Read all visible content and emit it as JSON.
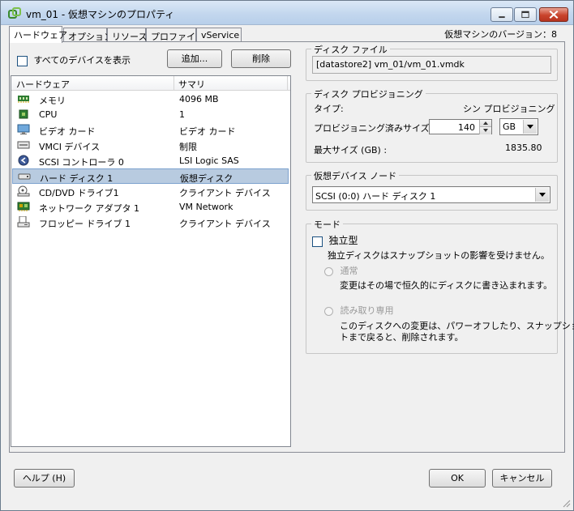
{
  "window": {
    "title": "vm_01 - 仮想マシンのプロパティ",
    "icon": "vm-icon"
  },
  "tabs": [
    {
      "label": "ハードウェア",
      "active": true
    },
    {
      "label": "オプション",
      "active": false
    },
    {
      "label": "リソース",
      "active": false
    },
    {
      "label": "プロファイル",
      "active": false
    },
    {
      "label": "vService",
      "active": false
    }
  ],
  "version_label": "仮想マシンのバージョン：8",
  "hardware": {
    "show_all_label": "すべてのデバイスを表示",
    "add_button": "追加...",
    "remove_button": "削除",
    "columns": [
      "ハードウェア",
      "サマリ"
    ],
    "rows": [
      {
        "icon": "memory-icon",
        "name": "メモリ",
        "summary": "4096 MB"
      },
      {
        "icon": "cpu-icon",
        "name": "CPU",
        "summary": "1"
      },
      {
        "icon": "video-card-icon",
        "name": "ビデオ カード",
        "summary": "ビデオ カード"
      },
      {
        "icon": "vmci-device-icon",
        "name": "VMCI デバイス",
        "summary": "制限"
      },
      {
        "icon": "scsi-controller-icon",
        "name": "SCSI コントローラ 0",
        "summary": "LSI Logic SAS"
      },
      {
        "icon": "hard-disk-icon",
        "name": "ハード ディスク 1",
        "summary": "仮想ディスク",
        "selected": true
      },
      {
        "icon": "cd-dvd-icon",
        "name": "CD/DVD ドライブ1",
        "summary": "クライアント デバイス"
      },
      {
        "icon": "network-adapter-icon",
        "name": "ネットワーク アダプタ 1",
        "summary": "VM Network"
      },
      {
        "icon": "floppy-drive-icon",
        "name": "フロッピー ドライブ 1",
        "summary": "クライアント デバイス"
      }
    ]
  },
  "disk_file": {
    "legend": "ディスク ファイル",
    "path": "[datastore2] vm_01/vm_01.vmdk"
  },
  "provisioning": {
    "legend": "ディスク プロビジョニング",
    "type_label": "タイプ:",
    "type_value": "シン プロビジョニング",
    "size_label": "プロビジョニング済みサイズ:",
    "size_value": "140",
    "size_unit": "GB",
    "max_label": "最大サイズ (GB) :",
    "max_value": "1835.80"
  },
  "virtual_device_node": {
    "legend": "仮想デバイス ノード",
    "selected": "SCSI (0:0) ハード ディスク 1"
  },
  "mode": {
    "legend": "モード",
    "independent_label": "独立型",
    "independent_desc": "独立ディスクはスナップショットの影響を受けません。",
    "normal_label": "通常",
    "normal_desc": "変更はその場で恒久的にディスクに書き込まれます。",
    "readonly_label": "読み取り専用",
    "readonly_desc_1": "このディスクへの変更は、パワーオフしたり、スナップショッ",
    "readonly_desc_2": "トまで戻ると、削除されます。"
  },
  "footer": {
    "help_button": "ヘルプ (H)",
    "ok_button": "OK",
    "cancel_button": "キャンセル"
  },
  "colors": {
    "selection": "#b8cbe0",
    "close_button": "#c9442c"
  }
}
